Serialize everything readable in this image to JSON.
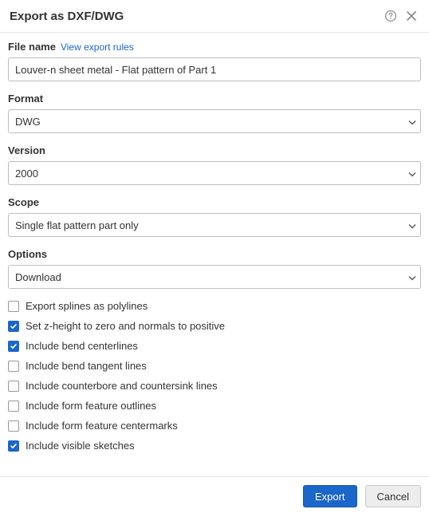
{
  "dialog": {
    "title": "Export as DXF/DWG"
  },
  "filename": {
    "label": "File name",
    "link": "View export rules",
    "value": "Louver-n sheet metal - Flat pattern of Part 1"
  },
  "format": {
    "label": "Format",
    "value": "DWG"
  },
  "version": {
    "label": "Version",
    "value": "2000"
  },
  "scope": {
    "label": "Scope",
    "value": "Single flat pattern part only"
  },
  "options": {
    "label": "Options",
    "value": "Download"
  },
  "checkboxes": [
    {
      "id": "splines",
      "label": "Export splines as polylines",
      "checked": false
    },
    {
      "id": "zheight",
      "label": "Set z-height to zero and normals to positive",
      "checked": true
    },
    {
      "id": "bend-center",
      "label": "Include bend centerlines",
      "checked": true
    },
    {
      "id": "bend-tangent",
      "label": "Include bend tangent lines",
      "checked": false
    },
    {
      "id": "counterbore",
      "label": "Include counterbore and countersink lines",
      "checked": false
    },
    {
      "id": "form-outline",
      "label": "Include form feature outlines",
      "checked": false
    },
    {
      "id": "form-center",
      "label": "Include form feature centermarks",
      "checked": false
    },
    {
      "id": "sketches",
      "label": "Include visible sketches",
      "checked": true
    }
  ],
  "footer": {
    "export": "Export",
    "cancel": "Cancel"
  }
}
